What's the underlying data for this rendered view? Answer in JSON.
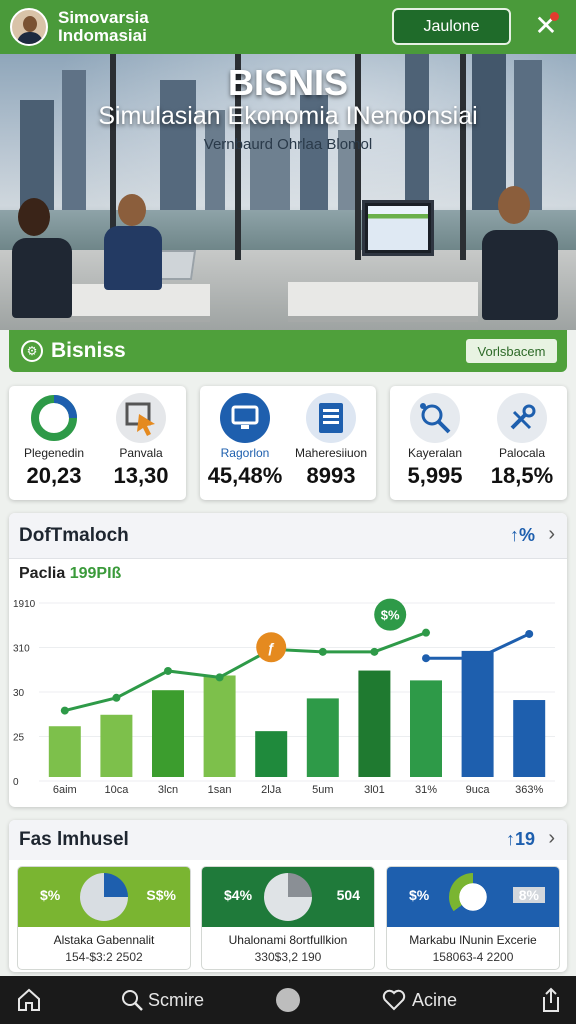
{
  "app": {
    "title_line1": "Simovarsia",
    "title_line2": "Indomasiai",
    "top_button": "Jaulone",
    "close_icon": "close-icon"
  },
  "hero": {
    "title": "BISNIS",
    "subtitle": "Simulasian Ekonomia INenoonsiai",
    "caption": "Vernbaurd Ohrlaa Blomol"
  },
  "section": {
    "label": "Bisniss",
    "button": "Vorlsbacem"
  },
  "stats": [
    {
      "label": "Plegenedin",
      "value": "20,23",
      "icon": "donut-chart-icon",
      "color": "#2e9a48"
    },
    {
      "label": "Panvala",
      "value": "13,30",
      "icon": "cursor-click-icon",
      "color": "#e58a1f"
    },
    {
      "label": "Ragorlon",
      "value": "45,48%",
      "icon": "monitor-icon",
      "color": "#1e5fae"
    },
    {
      "label": "Maheresiiuon",
      "value": "8993",
      "icon": "document-icon",
      "color": "#1e5fae"
    },
    {
      "label": "Kayeralan",
      "value": "5,995",
      "icon": "search-network-icon",
      "color": "#1e5fae"
    },
    {
      "label": "Palocala",
      "value": "18,5%",
      "icon": "tools-icon",
      "color": "#1e5fae"
    }
  ],
  "chart_card": {
    "title": "DofTmaloch",
    "action": "↑%",
    "subtitle_a": "Paclia ",
    "subtitle_b": "199PIß",
    "badge_orange": "ƒ",
    "badge_green": "$%"
  },
  "chart_data": {
    "type": "bar",
    "categories": [
      "6aim",
      "10ca",
      "3lcn",
      "1san",
      "2lJa",
      "5um",
      "3l01",
      "31%",
      "9uca",
      "363%"
    ],
    "y_tick_labels": [
      "1910",
      "310",
      "30",
      "25",
      "0"
    ],
    "bar_values": [
      0.31,
      0.38,
      0.53,
      0.62,
      0.28,
      0.48,
      0.65,
      0.59,
      0.77,
      0.47
    ],
    "bar_colors": [
      "#7dc04b",
      "#7dc04b",
      "#3c9d2e",
      "#7dc04b",
      "#1f8a3c",
      "#2e9a48",
      "#1f7a30",
      "#2e9a48",
      "#1e5fae",
      "#1e5fae"
    ],
    "line_series": [
      {
        "name": "",
        "points": [
          [
            0,
            0.52
          ],
          [
            1,
            0.62
          ],
          [
            2,
            0.83
          ],
          [
            3,
            0.78
          ],
          [
            4,
            1.0
          ],
          [
            5,
            0.98
          ],
          [
            6,
            0.98
          ],
          [
            7,
            1.13
          ]
        ],
        "color": "#2e9a48"
      },
      {
        "name": "",
        "points": [
          [
            7,
            0.93
          ],
          [
            8,
            0.93
          ],
          [
            9,
            1.12
          ]
        ],
        "color": "#1e5fae"
      }
    ]
  },
  "portfolio": {
    "title": "Fas lmhusel",
    "action": "↑19",
    "items": [
      {
        "left": "$%",
        "right": "S$%",
        "name": "Alstaka Gabennalit",
        "sub": "154-$3:2 2502",
        "band": "#7ab531",
        "pie_a": "#1e5fae",
        "pie_b": "#d8dde2"
      },
      {
        "left": "$4%",
        "right": "504",
        "name": "Uhalonami 8ortfullkion",
        "sub": "330$3,2 190",
        "band": "#1f7a3a",
        "pie_a": "#8a8f95",
        "pie_b": "#dfe3e6"
      },
      {
        "left": "$%",
        "right": "8%",
        "name": "Markabu lNunin Excerie",
        "sub": "158063-4 2200",
        "band": "#1e5fae",
        "pie_a": "#1e5fae",
        "pie_b": "#7ab531"
      }
    ]
  },
  "nav": {
    "home_icon": "home-icon",
    "search": "Scmire",
    "center_icon": "circle-icon",
    "favorites": "Acine",
    "share_icon": "share-icon"
  }
}
